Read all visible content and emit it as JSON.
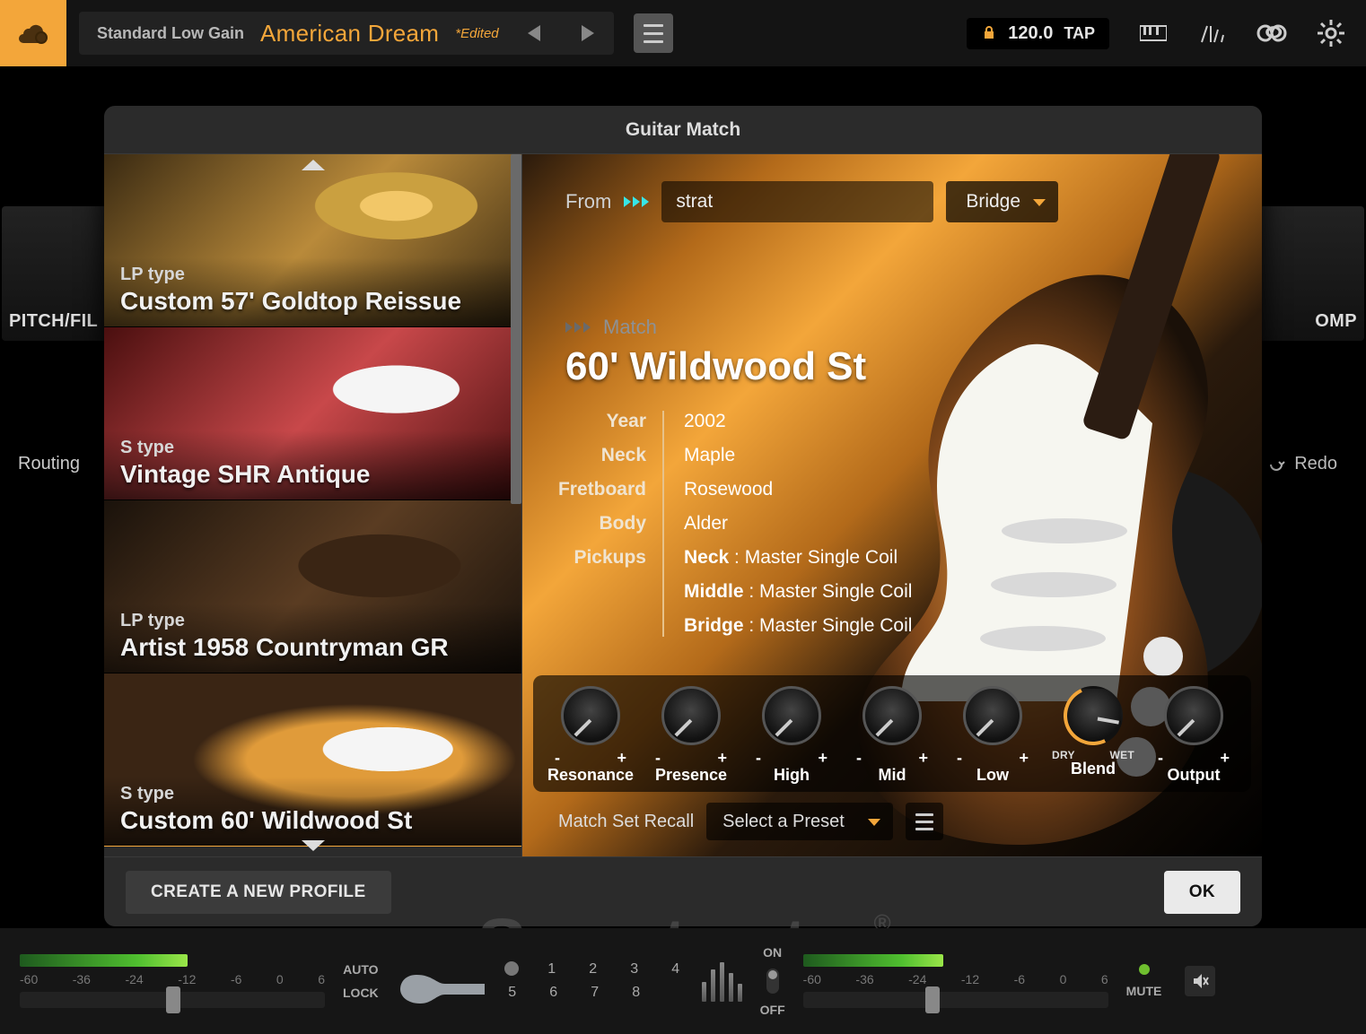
{
  "topbar": {
    "gain_mode": "Standard Low Gain",
    "preset_name": "American Dream",
    "edited_tag": "*Edited",
    "tempo": "120.0",
    "tap": "TAP"
  },
  "slots": {
    "left": "PITCH/FIL P",
    "right": "OMP"
  },
  "routing_label": "Routing",
  "redo_label": "Redo",
  "modal": {
    "title": "Guitar Match",
    "list": [
      {
        "type": "LP type",
        "name": "Custom 57' Goldtop Reissue"
      },
      {
        "type": "S type",
        "name": "Vintage SHR Antique"
      },
      {
        "type": "LP type",
        "name": "Artist 1958 Countryman GR"
      },
      {
        "type": "S type",
        "name": "Custom 60' Wildwood St"
      }
    ],
    "from_label": "From",
    "from_value": "strat",
    "pickup": "Bridge",
    "match_label": "Match",
    "match_name": "60' Wildwood St",
    "spec_keys": {
      "year": "Year",
      "neck": "Neck",
      "fret": "Fretboard",
      "body": "Body",
      "pickups": "Pickups"
    },
    "specs": {
      "year": "2002",
      "neck": "Maple",
      "fretboard": "Rosewood",
      "body": "Alder",
      "pu_neck_k": "Neck",
      "pu_neck_v": " : Master Single Coil",
      "pu_mid_k": "Middle",
      "pu_mid_v": " : Master Single Coil",
      "pu_br_k": "Bridge",
      "pu_br_v": " : Master Single Coil"
    },
    "knobs": {
      "minus": "-",
      "plus": "+",
      "dry": "DRY",
      "wet": "WET",
      "resonance": "Resonance",
      "presence": "Presence",
      "high": "High",
      "mid": "Mid",
      "low": "Low",
      "blend": "Blend",
      "output": "Output"
    },
    "recall_label": "Match Set Recall",
    "recall_value": "Select a Preset",
    "create_profile": "CREATE A NEW PROFILE",
    "ok": "OK"
  },
  "rack": {
    "scale": [
      "-60",
      "-36",
      "-24",
      "-12",
      "-6",
      "0",
      "6"
    ],
    "auto": "AUTO",
    "lock": "LOCK",
    "on": "ON",
    "off": "OFF",
    "mute": "MUTE",
    "channels_top": [
      "1",
      "2",
      "3",
      "4"
    ],
    "channels_bot": [
      "5",
      "6",
      "7",
      "8"
    ]
  },
  "watermark": "Sweetwater"
}
